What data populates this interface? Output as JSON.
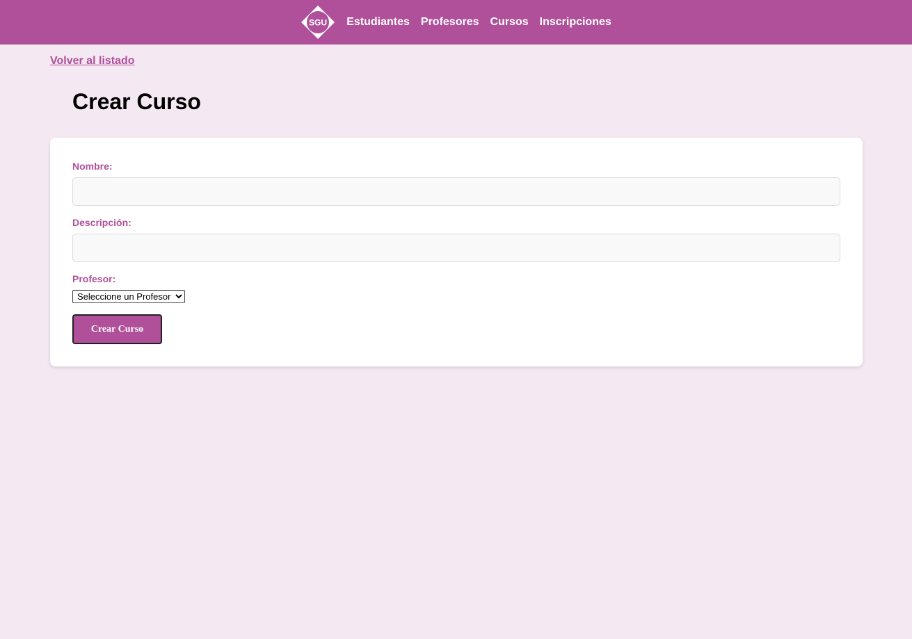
{
  "navbar": {
    "logo_text": "SGU",
    "links": [
      {
        "label": "Estudiantes"
      },
      {
        "label": "Profesores"
      },
      {
        "label": "Cursos"
      },
      {
        "label": "Inscripciones"
      }
    ]
  },
  "back_link": "Volver al listado",
  "page_title": "Crear Curso",
  "form": {
    "nombre_label": "Nombre:",
    "nombre_value": "",
    "descripcion_label": "Descripción:",
    "descripcion_value": "",
    "profesor_label": "Profesor:",
    "profesor_selected": "Seleccione un Profesor",
    "submit_label": "Crear Curso"
  },
  "colors": {
    "brand": "#b0509a",
    "page_background": "#f4e8f2",
    "card_background": "#ffffff"
  }
}
